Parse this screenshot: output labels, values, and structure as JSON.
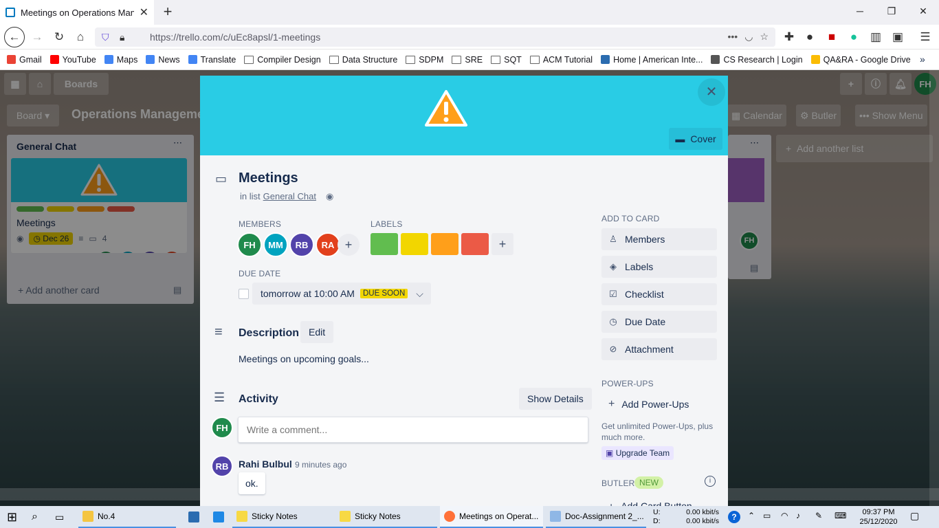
{
  "browser": {
    "tab_title": "Meetings on Operations Manag",
    "url": "https://trello.com/c/uEc8apsl/1-meetings",
    "bookmarks": [
      {
        "label": "Gmail",
        "color": "#ea4335"
      },
      {
        "label": "YouTube",
        "color": "#ff0000"
      },
      {
        "label": "Maps",
        "color": "#4285f4"
      },
      {
        "label": "News",
        "color": "#4285f4"
      },
      {
        "label": "Translate",
        "color": "#4285f4"
      },
      {
        "label": "Compiler Design",
        "folder": true
      },
      {
        "label": "Data Structure",
        "folder": true
      },
      {
        "label": "SDPM",
        "folder": true
      },
      {
        "label": "SRE",
        "folder": true
      },
      {
        "label": "SQT",
        "folder": true
      },
      {
        "label": "ACM Tutorial",
        "folder": true
      },
      {
        "label": "Home | American Inte...",
        "color": "#2b6cb0"
      },
      {
        "label": "CS Research | Login",
        "color": "#555555"
      },
      {
        "label": "QA&RA - Google Drive",
        "color": "#fbbc04"
      }
    ]
  },
  "board": {
    "header_boards": "Boards",
    "header_avatar": "FH",
    "board_view": "Board",
    "board_title": "Operations Manageme",
    "calendar": "Calendar",
    "butler": "Butler",
    "show_menu": "Show Menu",
    "list_title": "General Chat",
    "card_title": "Meetings",
    "card_due": "Dec 26",
    "card_comments": "4",
    "card_members": [
      "FH",
      "MM",
      "RB",
      "RA"
    ],
    "add_card": "Add another card",
    "add_list": "Add another list",
    "right_card_avatar": "FH"
  },
  "modal": {
    "title": "Meetings",
    "in_list_prefix": "in list",
    "list_name": "General Chat",
    "cover_label": "Cover",
    "members_heading": "MEMBERS",
    "members": [
      {
        "initials": "FH",
        "color": "#1f8a4c"
      },
      {
        "initials": "MM",
        "color": "#00a3bf"
      },
      {
        "initials": "RB",
        "color": "#5243aa"
      },
      {
        "initials": "RA",
        "color": "#e2401c"
      }
    ],
    "labels_heading": "LABELS",
    "labels": [
      "#61bd4f",
      "#f2d600",
      "#ff9f1a",
      "#eb5a46"
    ],
    "due_heading": "DUE DATE",
    "due_text": "tomorrow at 10:00 AM",
    "due_badge": "DUE SOON",
    "description_heading": "Description",
    "edit_label": "Edit",
    "description_text": "Meetings on upcoming goals...",
    "activity_heading": "Activity",
    "show_details": "Show Details",
    "comment_avatar": "FH",
    "comment_placeholder": "Write a comment...",
    "activity_author_initials": "RB",
    "activity_author": "Rahi Bulbul",
    "activity_time": "9 minutes ago",
    "activity_comment": "ok.",
    "add_to_card_heading": "ADD TO CARD",
    "sidebar_buttons": [
      "Members",
      "Labels",
      "Checklist",
      "Due Date",
      "Attachment"
    ],
    "powerups_heading": "POWER-UPS",
    "add_powerups": "Add Power-Ups",
    "powerups_text": "Get unlimited Power-Ups, plus much more.",
    "upgrade_team": "Upgrade Team",
    "butler_heading": "BUTLER",
    "butler_new": "NEW",
    "add_card_button": "Add Card Button"
  },
  "taskbar": {
    "items": [
      "No.4",
      "Sticky Notes",
      "Sticky Notes",
      "Meetings on Operat...",
      "Doc-Assignment 2_..."
    ],
    "net_up_label": "U:",
    "net_down_label": "D:",
    "net_up": "0.00 kbit/s",
    "net_down": "0.00 kbit/s",
    "time": "09:37 PM",
    "date": "25/12/2020"
  }
}
